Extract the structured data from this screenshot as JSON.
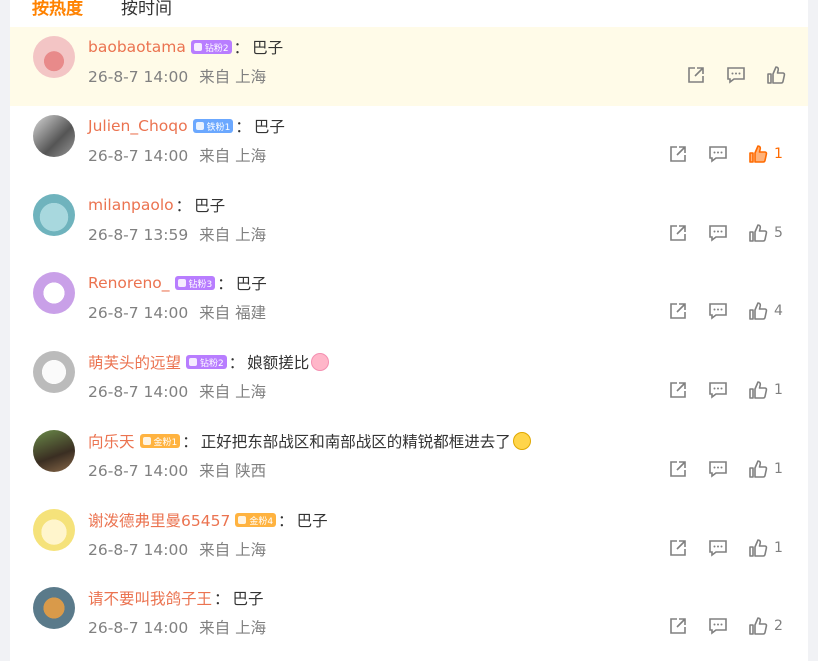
{
  "tabs": [
    {
      "label": "按热度",
      "active": true
    },
    {
      "label": "按时间",
      "active": false
    }
  ],
  "icons": {
    "share": "share-icon",
    "reply": "comment-icon",
    "like": "thumbs-up-icon"
  },
  "colors": {
    "accent": "#ff8200",
    "username": "#eb7350",
    "liked": "#ff6a00",
    "highlight_bg": "#fffbe8"
  },
  "comments": [
    {
      "username": "baobaotama",
      "badge": "钻粉2",
      "text": "巴子",
      "date": "26-8-7 14:00",
      "source": "来自 上海",
      "likes": ""
    },
    {
      "username": "Julien_Choqo",
      "badge": "铁粉1",
      "text": "巴子",
      "date": "26-8-7 14:00",
      "source": "来自 上海",
      "likes": "1"
    },
    {
      "username": "milanpaolo",
      "badge": "",
      "text": "巴子",
      "date": "26-8-7 13:59",
      "source": "来自 上海",
      "likes": "5"
    },
    {
      "username": "Renoreno_",
      "badge": "钻粉3",
      "text": "巴子",
      "date": "26-8-7 14:00",
      "source": "来自 福建",
      "likes": "4"
    },
    {
      "username": "萌芙头的远望",
      "badge": "钻粉2",
      "text": "娘额搓比",
      "date": "26-8-7 14:00",
      "source": "来自 上海",
      "likes": "1"
    },
    {
      "username": "向乐天",
      "badge": "金粉1",
      "text": "正好把东部战区和南部战区的精锐都框进去了",
      "date": "26-8-7 14:00",
      "source": "来自 陕西",
      "likes": "1"
    },
    {
      "username": "谢泼德弗里曼65457",
      "badge": "金粉4",
      "text": "巴子",
      "date": "26-8-7 14:00",
      "source": "来自 上海",
      "likes": "1"
    },
    {
      "username": "请不要叫我鸽子王",
      "badge": "",
      "text": "巴子",
      "date": "26-8-7 14:00",
      "source": "来自 上海",
      "likes": "2"
    }
  ]
}
